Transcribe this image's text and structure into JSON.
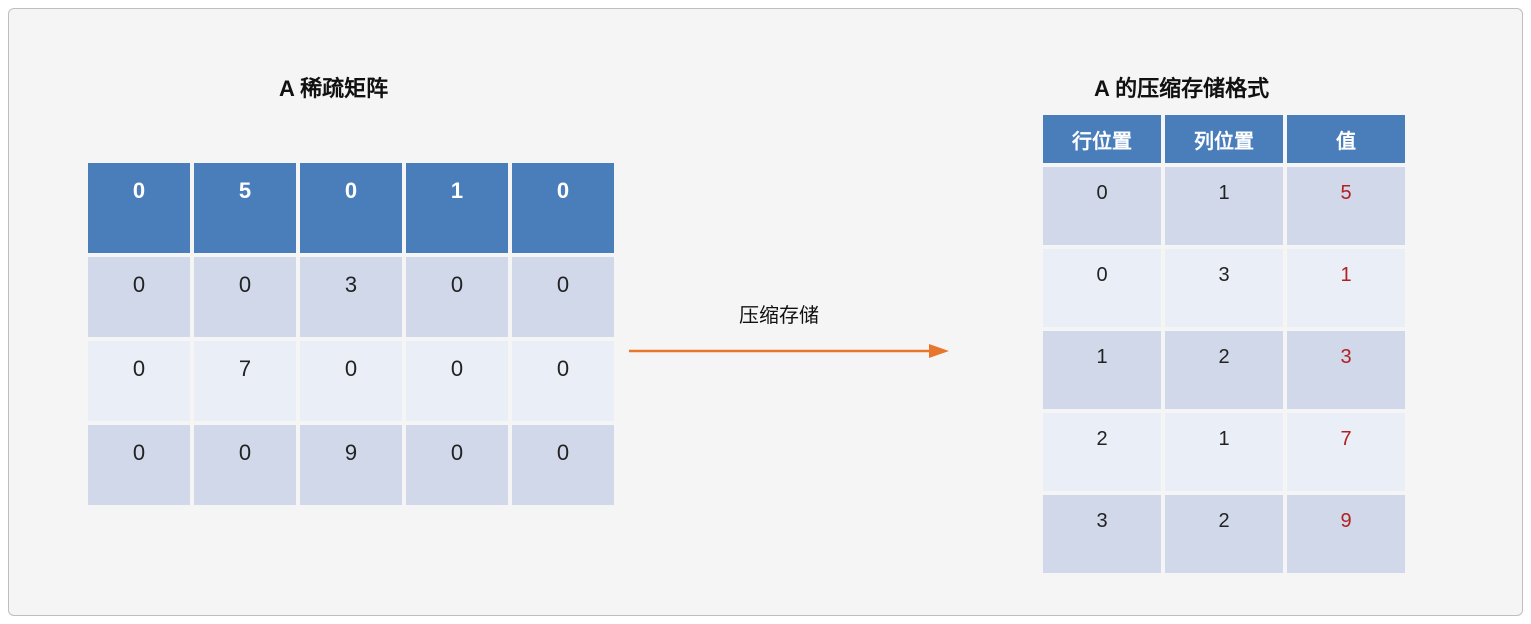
{
  "titles": {
    "left": "A 稀疏矩阵",
    "right": "A 的压缩存储格式"
  },
  "arrow_label": "压缩存储",
  "matrix": {
    "rows": [
      [
        "0",
        "5",
        "0",
        "1",
        "0"
      ],
      [
        "0",
        "0",
        "3",
        "0",
        "0"
      ],
      [
        "0",
        "7",
        "0",
        "0",
        "0"
      ],
      [
        "0",
        "0",
        "9",
        "0",
        "0"
      ]
    ]
  },
  "compressed": {
    "headers": [
      "行位置",
      "列位置",
      "值"
    ],
    "rows": [
      {
        "row": "0",
        "col": "1",
        "val": "5"
      },
      {
        "row": "0",
        "col": "3",
        "val": "1"
      },
      {
        "row": "1",
        "col": "2",
        "val": "3"
      },
      {
        "row": "2",
        "col": "1",
        "val": "7"
      },
      {
        "row": "3",
        "col": "2",
        "val": "9"
      }
    ]
  },
  "colors": {
    "header_bg": "#4a7ebb",
    "band_dark": "#d0d8ea",
    "band_light": "#eaeef6",
    "value_red": "#b22020",
    "arrow": "#e8762d"
  }
}
